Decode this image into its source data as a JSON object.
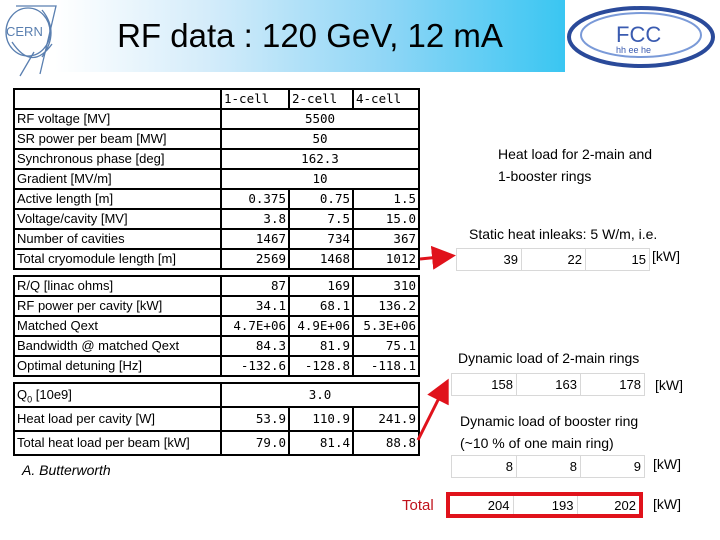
{
  "header": {
    "title": "RF data : 120 GeV, 12 mA",
    "left_logo": "CERN",
    "right_logo_main": "FCC",
    "right_logo_sub": "hh ee he"
  },
  "columns": [
    "1-cell",
    "2-cell",
    "4-cell"
  ],
  "table1": {
    "rows": [
      {
        "label": "RF voltage [MV]",
        "span": "5500"
      },
      {
        "label": "SR power per beam [MW]",
        "span": "50"
      },
      {
        "label": "Synchronous phase [deg]",
        "span": "162.3"
      },
      {
        "label": "Gradient [MV/m]",
        "span": "10"
      },
      {
        "label": "Active length [m]",
        "values": [
          "0.375",
          "0.75",
          "1.5"
        ]
      },
      {
        "label": "Voltage/cavity [MV]",
        "values": [
          "3.8",
          "7.5",
          "15.0"
        ]
      },
      {
        "label": "Number of cavities",
        "values": [
          "1467",
          "734",
          "367"
        ]
      },
      {
        "label": "Total cryomodule length [m]",
        "values": [
          "2569",
          "1468",
          "1012"
        ]
      }
    ]
  },
  "table2": {
    "rows": [
      {
        "label": "R/Q [linac ohms]",
        "values": [
          "87",
          "169",
          "310"
        ]
      },
      {
        "label": "RF power per cavity [kW]",
        "values": [
          "34.1",
          "68.1",
          "136.2"
        ]
      },
      {
        "label": "Matched Qext",
        "values": [
          "4.7E+06",
          "4.9E+06",
          "5.3E+06"
        ]
      },
      {
        "label": "Bandwidth @ matched Qext",
        "values": [
          "84.3",
          "81.9",
          "75.1"
        ]
      },
      {
        "label": "Optimal detuning [Hz]",
        "values": [
          "-132.6",
          "-128.8",
          "-118.1"
        ]
      }
    ]
  },
  "table3": {
    "q0_label_main": "Q",
    "q0_label_sub": "0",
    "q0_label_rest": " [10e9]",
    "q0_value": "3.0",
    "rows": [
      {
        "label": "Heat load per cavity [W]",
        "values": [
          "53.9",
          "110.9",
          "241.9"
        ]
      },
      {
        "label": "Total heat load per beam [kW]",
        "values": [
          "79.0",
          "81.4",
          "88.8"
        ]
      }
    ]
  },
  "author": "A. Butterworth",
  "annotations": {
    "heat_load_title_line1": "Heat load for 2-main and",
    "heat_load_title_line2": "1-booster rings",
    "static_label": "Static heat inleaks: 5 W/m, i.e.",
    "static_values": [
      "39",
      "22",
      "15"
    ],
    "static_unit": "[kW]",
    "dyn_main_label": "Dynamic load of 2-main rings",
    "dyn_main_values": [
      "158",
      "163",
      "178"
    ],
    "dyn_main_unit": "[kW]",
    "dyn_booster_line1": "Dynamic load of booster ring",
    "dyn_booster_line2": "(~10 % of one main ring)",
    "dyn_booster_values": [
      "8",
      "8",
      "9"
    ],
    "dyn_booster_unit": "[kW]",
    "total_label": "Total",
    "total_values": [
      "204",
      "193",
      "202"
    ],
    "total_unit": "[kW]"
  },
  "colors": {
    "accent_red": "#e0121b",
    "banner_cyan": "#3ac6f2",
    "logo_blue": "#2a4a9a"
  }
}
